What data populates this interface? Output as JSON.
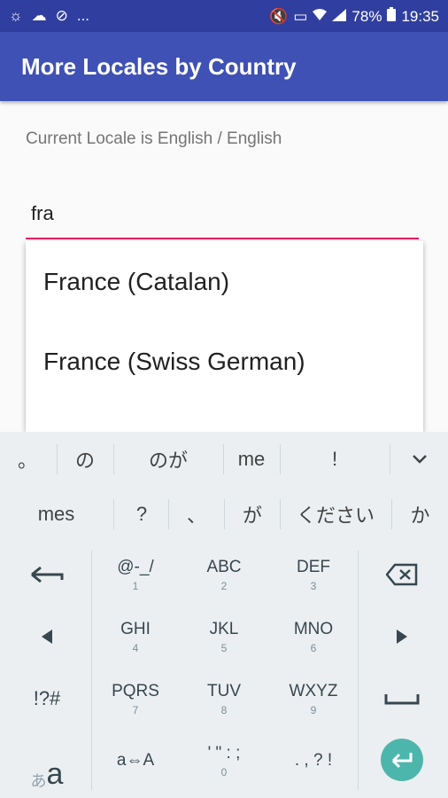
{
  "status": {
    "left_icons": [
      "brightness-icon",
      "cloud-icon",
      "block-icon",
      "more-icon"
    ],
    "more_text": "...",
    "battery": "78%",
    "time": "19:35"
  },
  "appbar": {
    "title": "More Locales by Country"
  },
  "locale_text": "Current Locale is English / English",
  "search": {
    "value": "fra"
  },
  "dropdown": {
    "items": [
      "France (Catalan)",
      "France (Swiss German)"
    ]
  },
  "keyboard": {
    "candidates_row1": [
      "。",
      "の",
      "のが",
      "me",
      "!"
    ],
    "candidates_row2": [
      "mes",
      "?",
      "、",
      "が",
      "ください",
      "か"
    ],
    "keys": {
      "sym": {
        "main": "@-_/",
        "sub": "1"
      },
      "abc": {
        "main": "ABC",
        "sub": "2"
      },
      "def": {
        "main": "DEF",
        "sub": "3"
      },
      "ghi": {
        "main": "GHI",
        "sub": "4"
      },
      "jkl": {
        "main": "JKL",
        "sub": "5"
      },
      "mno": {
        "main": "MNO",
        "sub": "6"
      },
      "pqrs": {
        "main": "PQRS",
        "sub": "7"
      },
      "tuv": {
        "main": "TUV",
        "sub": "8"
      },
      "wxyz": {
        "main": "WXYZ",
        "sub": "9"
      },
      "case": {
        "main": "a⇔A"
      },
      "punct1": {
        "main": "' \" : ;",
        "sub": "0"
      },
      "punct2": {
        "main": ". , ? !"
      },
      "symbols": {
        "main": "!?#"
      },
      "lang_small": "あ",
      "lang_big": "a"
    }
  }
}
